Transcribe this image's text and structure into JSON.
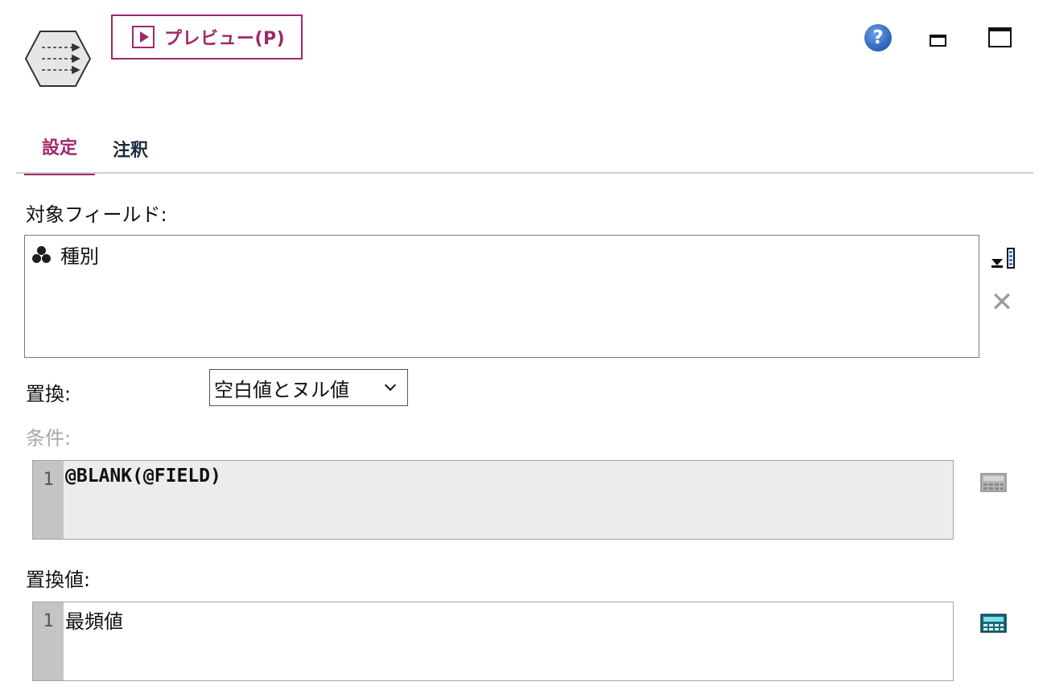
{
  "header": {
    "preview_label": "プレビュー(P)",
    "help_glyph": "?"
  },
  "tabs": [
    {
      "label": "設定",
      "active": true
    },
    {
      "label": "注釈",
      "active": false
    }
  ],
  "settings": {
    "target_fields_label": "対象フィールド:",
    "target_fields": [
      {
        "name": "種別",
        "icon": "nominal-set-icon"
      }
    ],
    "replace_label": "置換:",
    "replace_selected": "空白値とヌル値",
    "condition_label": "条件:",
    "condition_line_number": "1",
    "condition_code": "@BLANK(@FIELD)",
    "replace_value_label": "置換値:",
    "replace_value_line_number": "1",
    "replace_value_code": "最頻値"
  },
  "colors": {
    "accent": "#a0286e",
    "help_blue": "#2c62b8"
  }
}
